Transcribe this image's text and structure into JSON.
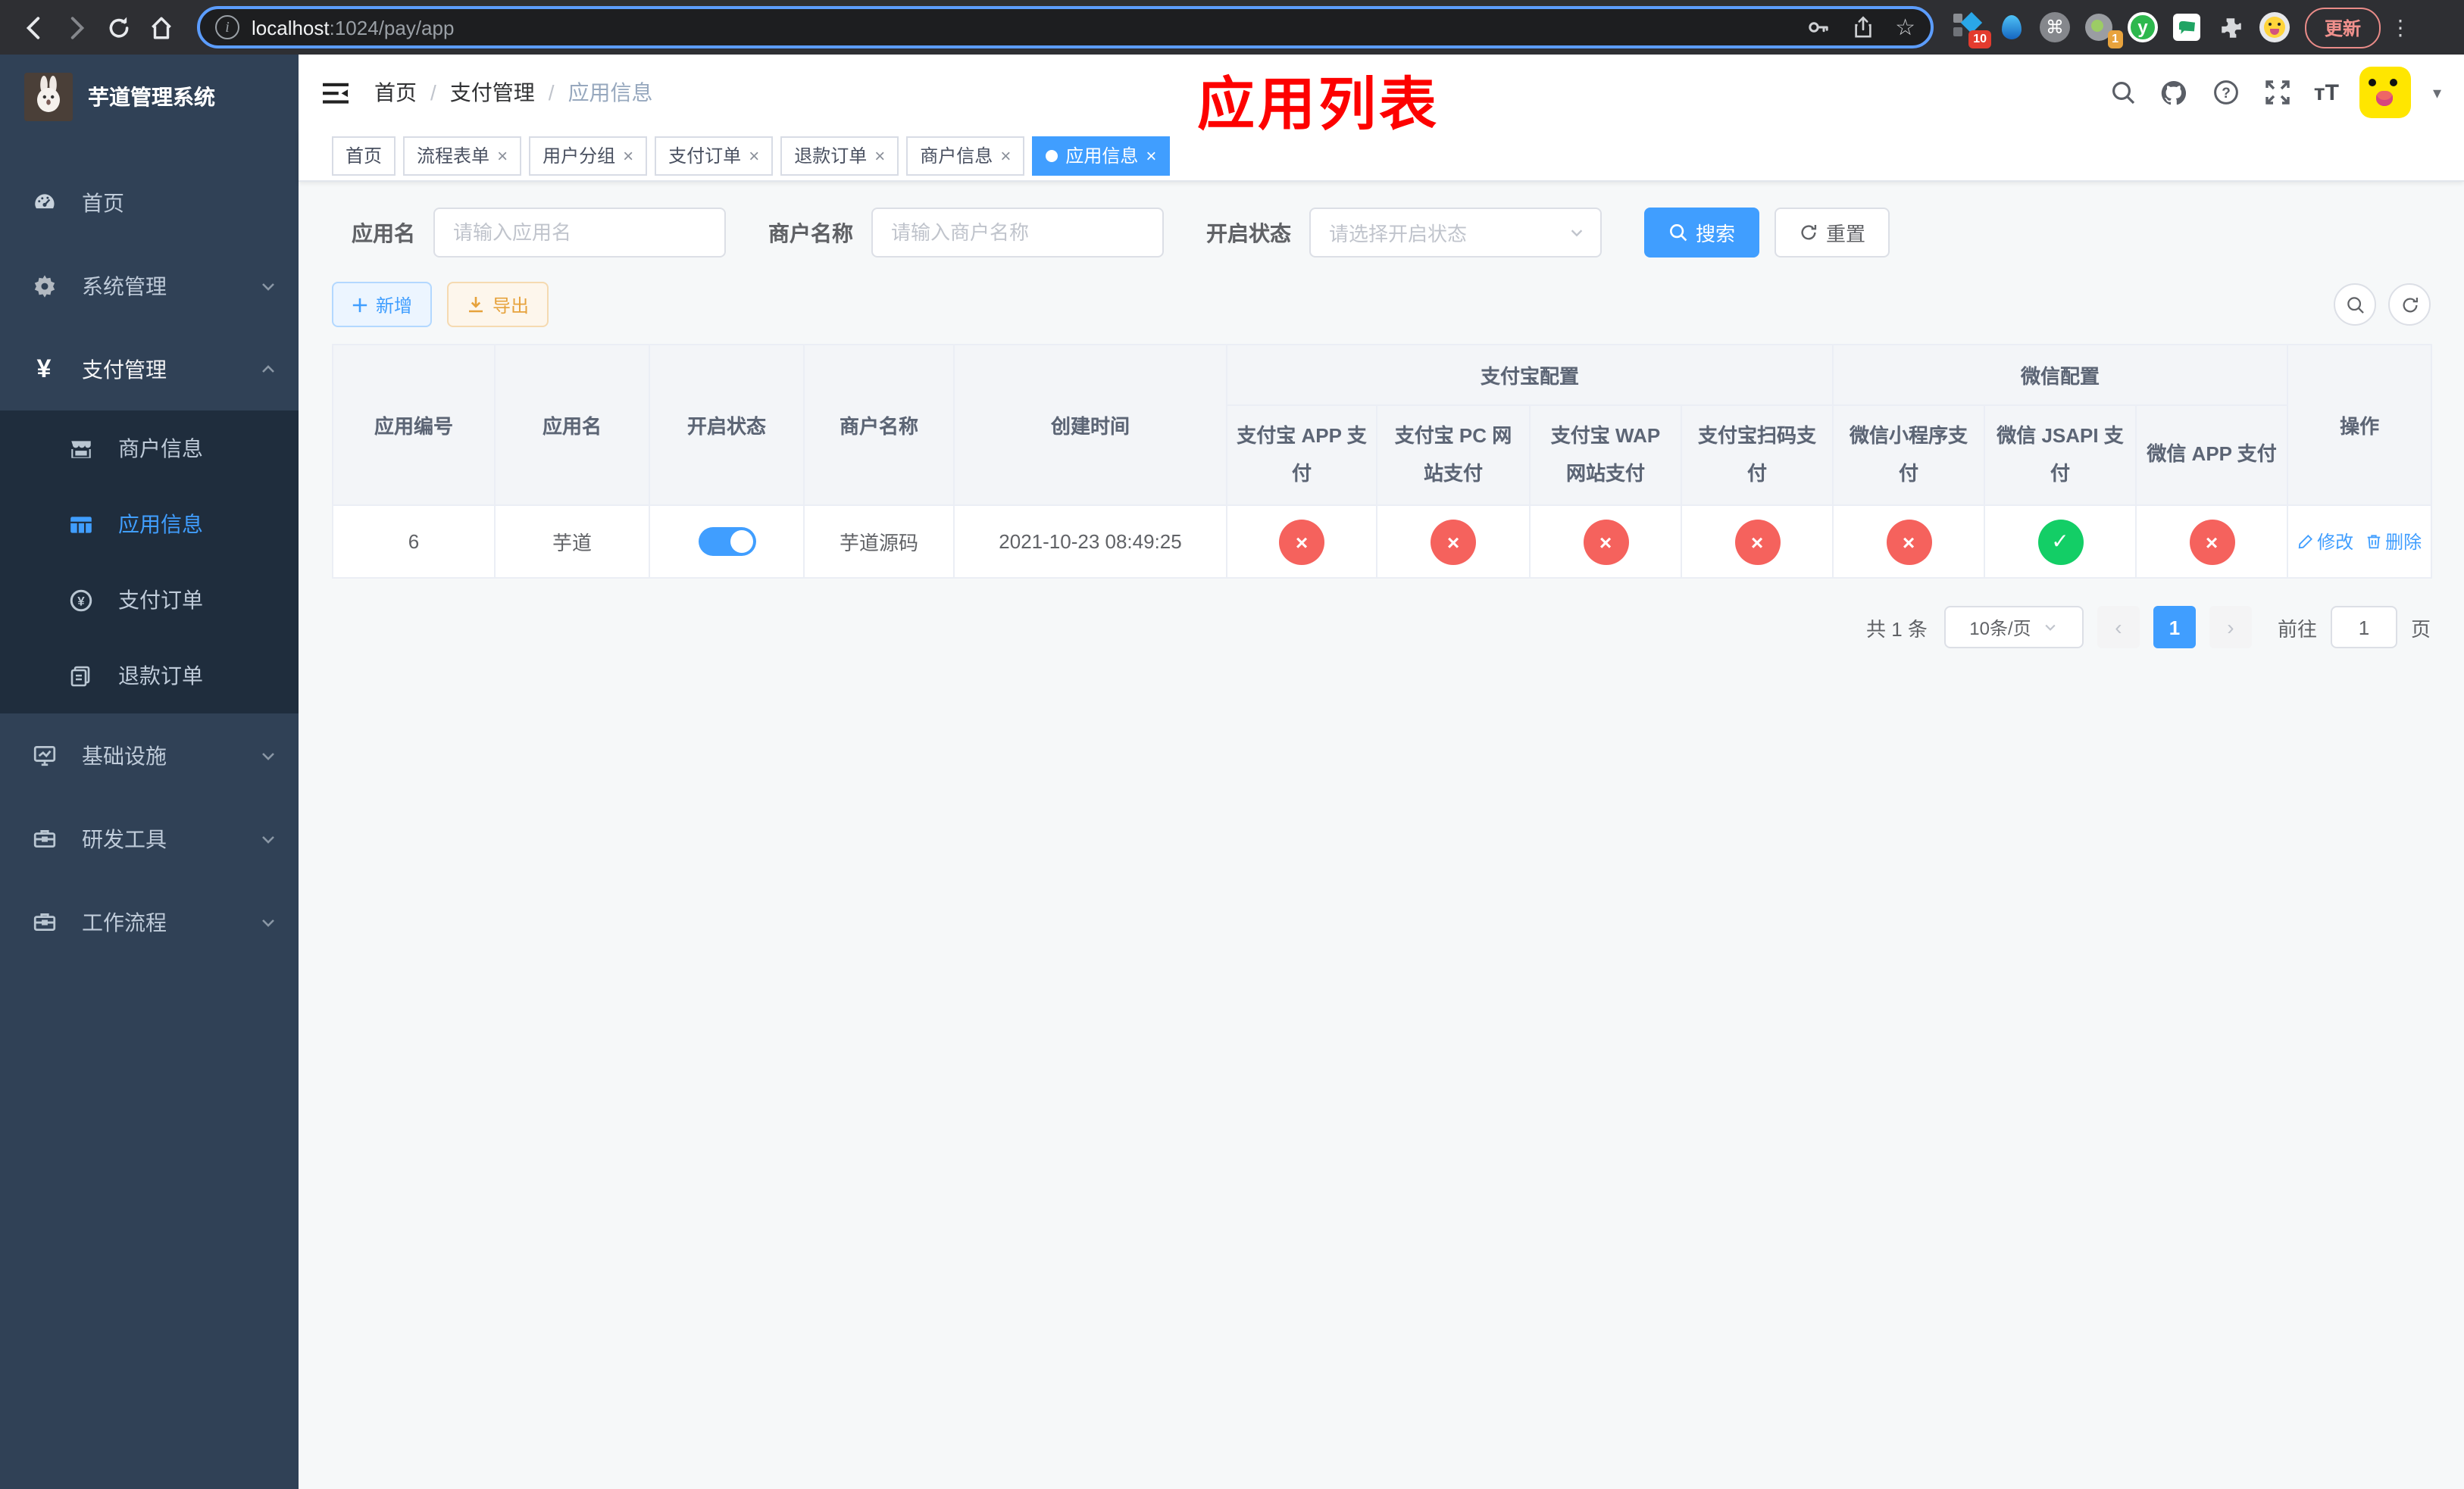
{
  "icons": {
    "close": "×",
    "check": "✓",
    "cross": "×",
    "caret": "▾",
    "command": "⌘",
    "dots": "⋮",
    "star": "☆",
    "yen": "¥",
    "prev": "‹",
    "next": "›",
    "question": "?",
    "y_letter": "y",
    "tT": "тT",
    "info": "i"
  },
  "browser": {
    "url_host": "localhost",
    "url_path": ":1024/pay/app",
    "ext_badge_10": "10",
    "ext_badge_1": "1",
    "update_label": "更新"
  },
  "sidebar": {
    "title": "芋道管理系统",
    "items": [
      {
        "label": "首页"
      },
      {
        "label": "系统管理"
      },
      {
        "label": "支付管理"
      },
      {
        "label": "商户信息"
      },
      {
        "label": "应用信息"
      },
      {
        "label": "支付订单"
      },
      {
        "label": "退款订单"
      },
      {
        "label": "基础设施"
      },
      {
        "label": "研发工具"
      },
      {
        "label": "工作流程"
      }
    ]
  },
  "navbar": {
    "breadcrumb": [
      "首页",
      "支付管理",
      "应用信息"
    ],
    "separator": "/"
  },
  "annotation": "应用列表",
  "tags": [
    {
      "label": "首页"
    },
    {
      "label": "流程表单"
    },
    {
      "label": "用户分组"
    },
    {
      "label": "支付订单"
    },
    {
      "label": "退款订单"
    },
    {
      "label": "商户信息"
    },
    {
      "label": "应用信息"
    }
  ],
  "filters": {
    "name_label": "应用名",
    "name_ph": "请输入应用名",
    "merchant_label": "商户名称",
    "merchant_ph": "请输入商户名称",
    "status_label": "开启状态",
    "status_ph": "请选择开启状态",
    "search_label": "搜索",
    "reset_label": "重置"
  },
  "toolbar": {
    "add_label": "新增",
    "export_label": "导出"
  },
  "table": {
    "columns": [
      "应用编号",
      "应用名",
      "开启状态",
      "商户名称",
      "创建时间"
    ],
    "alipay_group": "支付宝配置",
    "alipay_cols": [
      "支付宝 APP 支付",
      "支付宝 PC 网站支付",
      "支付宝 WAP 网站支付",
      "支付宝扫码支付"
    ],
    "wechat_group": "微信配置",
    "wechat_cols": [
      "微信小程序支付",
      "微信 JSAPI 支付",
      "微信 APP 支付"
    ],
    "op_col": "操作",
    "rows": [
      {
        "id": "6",
        "name": "芋道",
        "merchant": "芋道源码",
        "created": "2021-10-23 08:49:25",
        "statuses": [
          {
            "state": "off",
            "glyph": "×"
          },
          {
            "state": "off",
            "glyph": "×"
          },
          {
            "state": "off",
            "glyph": "×"
          },
          {
            "state": "off",
            "glyph": "×"
          },
          {
            "state": "off",
            "glyph": "×"
          },
          {
            "state": "on",
            "glyph": "✓"
          },
          {
            "state": "off",
            "glyph": "×"
          }
        ],
        "edit_label": "修改",
        "delete_label": "删除"
      }
    ]
  },
  "pagination": {
    "total": "共 1 条",
    "page_size": "10条/页",
    "current_page": "1",
    "goto_label": "前往",
    "goto_value": "1",
    "unit_label": "页"
  },
  "colors": {
    "primary": "#409eff",
    "danger": "#f5625d",
    "success": "#13ce66",
    "annotation": "#fd0100"
  }
}
